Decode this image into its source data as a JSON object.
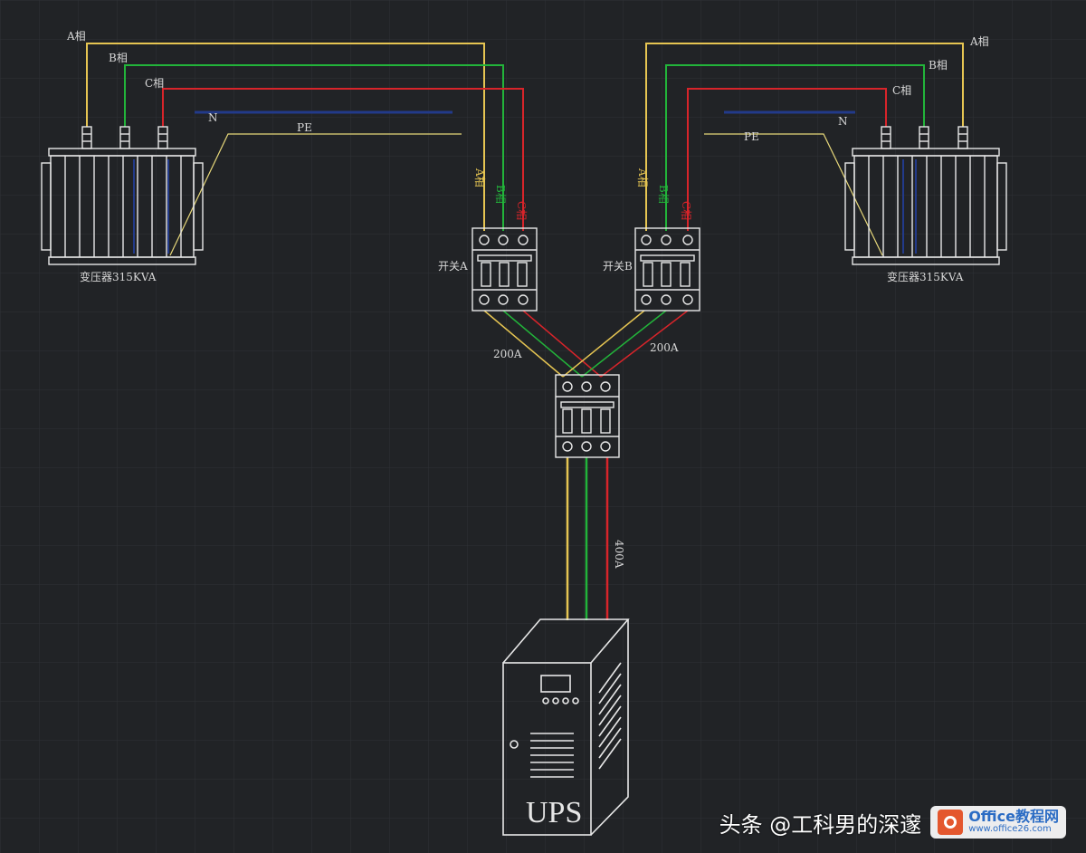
{
  "colors": {
    "background": "#212326",
    "grid": "#2e3236",
    "phase_a": "#e6c552",
    "phase_b": "#22b43a",
    "phase_c": "#d8242a",
    "neutral": "#223a8a",
    "pe": "#e6d77a",
    "device_outline": "#e8e8e8"
  },
  "left_transformer": {
    "label": "变压器315KVA",
    "phase_a": "A相",
    "phase_b": "B相",
    "phase_c": "C相",
    "neutral": "N",
    "pe": "PE"
  },
  "right_transformer": {
    "label": "变压器315KVA",
    "phase_a": "A相",
    "phase_b": "B相",
    "phase_c": "C相",
    "neutral": "N",
    "pe": "PE"
  },
  "switch_a": {
    "label": "开关A",
    "phase_a": "A相",
    "phase_b": "B相",
    "phase_c": "C相",
    "rating": "200A"
  },
  "switch_b": {
    "label": "开关B",
    "phase_a": "A相",
    "phase_b": "B相",
    "phase_c": "C相",
    "rating": "200A"
  },
  "main_breaker": {
    "rating": "400A"
  },
  "ups": {
    "label": "UPS"
  },
  "watermark": {
    "text": "头条 @工科男的深邃",
    "brand": "Office教程网",
    "url": "www.office26.com"
  }
}
